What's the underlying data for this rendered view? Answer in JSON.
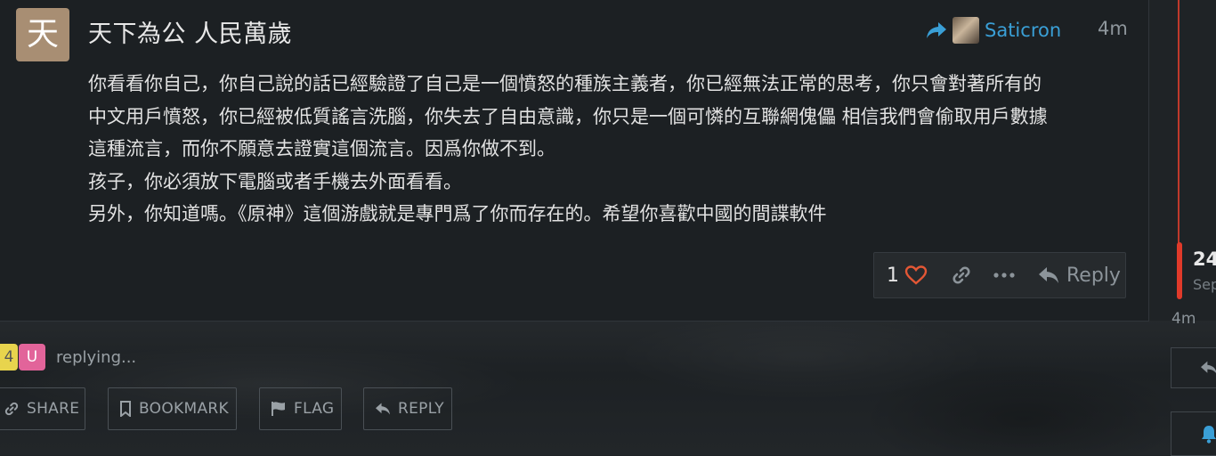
{
  "post": {
    "avatar_letter": "天",
    "username": "天下為公 人民萬歲",
    "reply_to_user": "Saticron",
    "time": "4m",
    "body_lines": [
      "你看看你自己，你自己說的話已經驗證了自己是一個憤怒的種族主義者，你已經無法正常的思考，你只會對著所有的",
      "中文用戶憤怒，你已經被低質謠言洗腦，你失去了自由意識，你只是一個可憐的互聯網傀儡 相信我們會偷取用戶數據",
      "這種流言，而你不願意去證實這個流言。因爲你做不到。",
      "孩子，你必須放下電腦或者手機去外面看看。",
      "另外，你知道嗎。《原神》這個游戲就是專門爲了你而存在的。希望你喜歡中國的間諜軟件"
    ],
    "like_count": "1",
    "reply_label": "Reply"
  },
  "timeline": {
    "count": "24",
    "date": "Sep",
    "time": "4m"
  },
  "replying": {
    "avatars": [
      "4",
      "U"
    ],
    "text": "replying..."
  },
  "footer": {
    "share": "SHARE",
    "bookmark": "BOOKMARK",
    "flag": "FLAG",
    "reply": "REPLY"
  },
  "colors": {
    "accent_link": "#3a9fd6",
    "like_heart": "#e45735",
    "timeline": "#e03a2a"
  }
}
